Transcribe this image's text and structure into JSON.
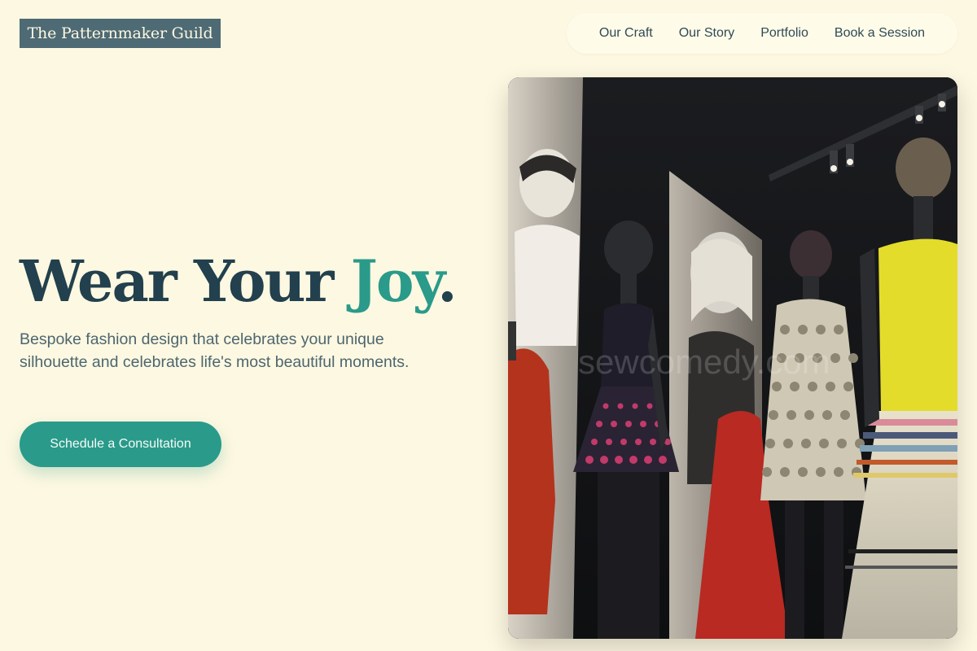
{
  "brand": {
    "name": "The Patternmaker Guild"
  },
  "nav": {
    "items": [
      {
        "label": "Our Craft"
      },
      {
        "label": "Our Story"
      },
      {
        "label": "Portfolio"
      },
      {
        "label": "Book a Session"
      }
    ]
  },
  "hero": {
    "title_part1": "Wear Your ",
    "title_accent": "Joy",
    "title_end": ".",
    "subtitle": "Bespoke fashion design that celebrates your unique silhouette and celebrates life's most beautiful moments.",
    "cta_label": "Schedule a Consultation",
    "image": {
      "description_icon": "mannequin-exhibit-photo",
      "watermark": "sewcomedy.com"
    }
  },
  "colors": {
    "background": "#fdf8e1",
    "logo_bg": "#4e6a74",
    "accent": "#2a9a8a",
    "heading": "#22404d",
    "body_text": "#4d6670"
  }
}
